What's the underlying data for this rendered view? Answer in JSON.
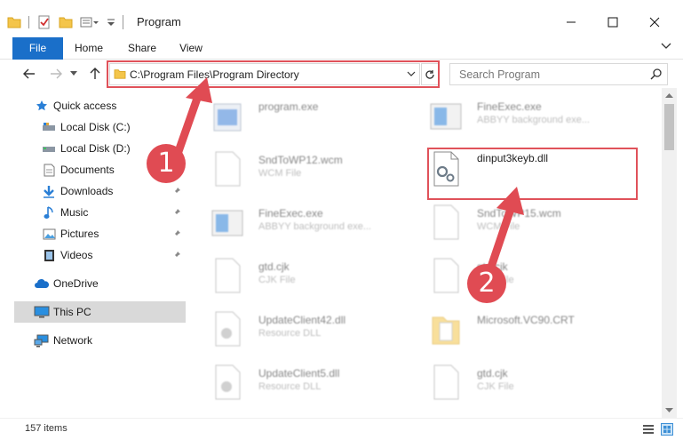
{
  "window": {
    "title": "Program"
  },
  "ribbon": {
    "tabs": [
      "File",
      "Home",
      "Share",
      "View"
    ]
  },
  "address": {
    "path": "C:\\Program Files\\Program Directory",
    "search_placeholder": "Search Program"
  },
  "sidebar": {
    "items": [
      {
        "label": "Quick access",
        "icon": "star-icon"
      },
      {
        "label": "Local Disk (C:)",
        "icon": "drive-icon"
      },
      {
        "label": "Local Disk (D:)",
        "icon": "drive-icon"
      },
      {
        "label": "Documents",
        "icon": "documents-icon"
      },
      {
        "label": "Downloads",
        "icon": "downloads-icon"
      },
      {
        "label": "Music",
        "icon": "music-icon"
      },
      {
        "label": "Pictures",
        "icon": "pictures-icon"
      },
      {
        "label": "Videos",
        "icon": "videos-icon"
      },
      {
        "label": "OneDrive",
        "icon": "cloud-icon"
      },
      {
        "label": "This PC",
        "icon": "monitor-icon"
      },
      {
        "label": "Network",
        "icon": "network-icon"
      }
    ]
  },
  "files": [
    {
      "name": "program.exe",
      "type": ""
    },
    {
      "name": "FineExec.exe",
      "type": "ABBYY background exe..."
    },
    {
      "name": "SndToWP12.wcm",
      "type": "WCM File"
    },
    {
      "name": "dinput3keyb.dll",
      "type": ""
    },
    {
      "name": "FineExec.exe",
      "type": "ABBYY background exe..."
    },
    {
      "name": "SndToWP15.wcm",
      "type": "WCM File"
    },
    {
      "name": "gtd.cjk",
      "type": "CJK File"
    },
    {
      "name": "gtd.cjk",
      "type": "CJK File"
    },
    {
      "name": "UpdateClient42.dll",
      "type": "Resource DLL"
    },
    {
      "name": "Microsoft.VC90.CRT",
      "type": ""
    },
    {
      "name": "UpdateClient5.dll",
      "type": "Resource DLL"
    },
    {
      "name": "gtd.cjk",
      "type": "CJK File"
    }
  ],
  "status": {
    "count": "157 items"
  },
  "annotations": {
    "step1": "1",
    "step2": "2"
  },
  "colors": {
    "accent": "#1a6fc9",
    "highlight": "#e0525a"
  }
}
